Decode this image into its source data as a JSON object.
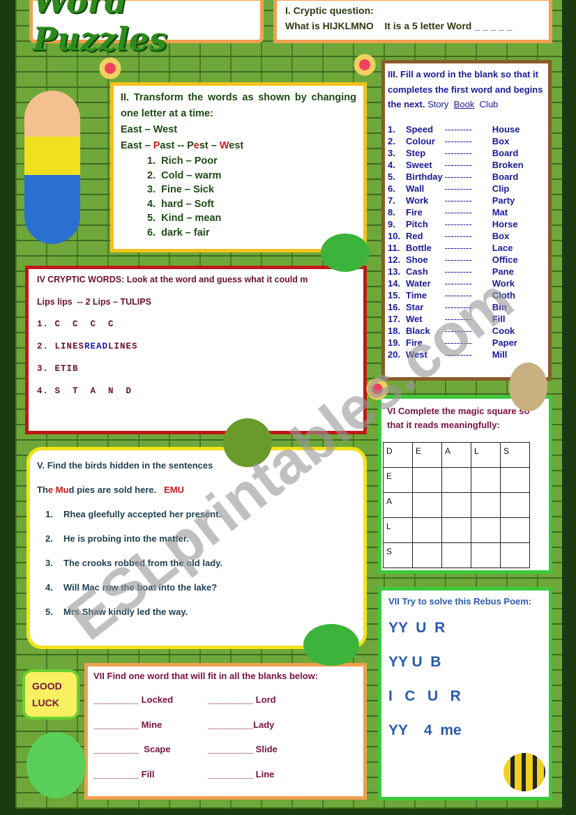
{
  "title": "Word Puzzles",
  "section1": {
    "heading": "I. Cryptic question:",
    "question": "What is HIJKLMNO    It is a 5 letter Word _ _ _ _ _"
  },
  "section2": {
    "heading": "II. Transform the words as shown by changing one letter at a time:",
    "example1": "East – West",
    "example2_parts": [
      "East – ",
      "P",
      "ast -- P",
      "e",
      "st – ",
      "W",
      "est"
    ],
    "items": [
      "1.  Rich – Poor",
      "2.  Cold – warm",
      "3.  Fine – Sick",
      "4.  hard – Soft",
      "5.  Kind – mean",
      "6.  dark – fair"
    ]
  },
  "section3": {
    "heading": "III. Fill a word in the blank so that it completes the first word and begins the next.",
    "example_a": "Story",
    "example_b": "Book",
    "example_c": "Club",
    "items": [
      [
        "1.",
        "Speed",
        "House"
      ],
      [
        "2.",
        "Colour",
        "Box"
      ],
      [
        "3.",
        "Step",
        "Board"
      ],
      [
        "4.",
        "Sweet",
        "Broken"
      ],
      [
        "5.",
        "Birthday",
        "Board"
      ],
      [
        "6.",
        "Wall",
        "Clip"
      ],
      [
        "7.",
        "Work",
        "Party"
      ],
      [
        "8.",
        "Fire",
        "Mat"
      ],
      [
        "9.",
        "Pitch",
        "Horse"
      ],
      [
        "10.",
        "Red",
        "Box"
      ],
      [
        "11.",
        "Bottle",
        "Lace"
      ],
      [
        "12.",
        "Shoe",
        "Office"
      ],
      [
        "13.",
        "Cash",
        "Pane"
      ],
      [
        "14.",
        "Water",
        "Work"
      ],
      [
        "15.",
        "Time",
        "Cloth"
      ],
      [
        "16.",
        "Star",
        "Bin"
      ],
      [
        "17.",
        "Wet",
        "Fill"
      ],
      [
        "18.",
        "Black",
        "Cook"
      ],
      [
        "19.",
        "Fire",
        "Paper"
      ],
      [
        "20.",
        "West",
        "Mill"
      ]
    ],
    "dashes": "---------"
  },
  "section4": {
    "heading": "IV CRYPTIC WORDS: Look at the word and guess what it could m",
    "example": "Lips lips  -- 2 Lips – TULIPS",
    "item1": "1. C  C  C  C",
    "item2_parts": [
      "2. LINES",
      "READ",
      "LINES"
    ],
    "item3": "3. ETIB",
    "item4": "4. S  T  A  N  D"
  },
  "section5": {
    "heading": "V. Find the birds hidden in the sentences",
    "example_parts": [
      "Th",
      "e Mu",
      "d pies are sold here.   ",
      "EMU"
    ],
    "items": [
      [
        "1.",
        "Rhea gleefully accepted her present."
      ],
      [
        "2.",
        "He is probing into the matter."
      ],
      [
        "3.",
        "The crooks robbed from the old lady."
      ],
      [
        "4.",
        "Will Mac row the boat into the lake?"
      ],
      [
        "5.",
        "Mrs Shaw kindly led the way."
      ]
    ]
  },
  "section6": {
    "heading": "VI Complete the magic square so that it reads meaningfully:",
    "row1": [
      "D",
      "E",
      "A",
      "L",
      "S"
    ],
    "col1": [
      "E",
      "A",
      "L",
      "S"
    ]
  },
  "section7_rebus": {
    "heading": "VII Try to solve this Rebus Poem:",
    "lines": [
      "YY  U  R",
      "YY U  B",
      "I   C   U   R",
      "YY    4  me"
    ]
  },
  "section7_blanks": {
    "heading": "VII Find one word that will fit in all the blanks below:",
    "rows": [
      [
        "_________ Locked",
        "_________ Lord"
      ],
      [
        "_________ Mine",
        "_________Lady"
      ],
      [
        "_________  Scape",
        "_________ Slide"
      ],
      [
        "_________ Fill",
        "_________ Line"
      ]
    ]
  },
  "good_luck": [
    "GOOD",
    "LUCK"
  ],
  "watermark": "ESLprintables.com",
  "colors": {
    "background_green": "#6fa83a",
    "title_green": "#2e8b1e",
    "section3_blue": "#1a1ab8",
    "maroon": "#7a1040",
    "highlight_red": "#d01818"
  }
}
